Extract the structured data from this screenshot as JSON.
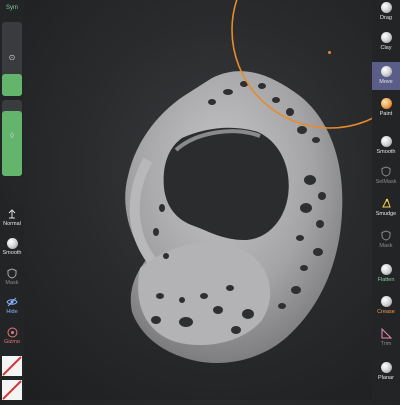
{
  "left_bar": {
    "sym_label": "Sym",
    "radius_slider_level": 0.3,
    "intensity_slider_level": 0.85,
    "tools": [
      {
        "name": "normal",
        "label": "Normal",
        "icon": "arrow-up-icon"
      },
      {
        "name": "smooth",
        "label": "Smooth",
        "icon": "smooth-brush-icon"
      },
      {
        "name": "mask",
        "label": "Mask",
        "icon": "mask-shield-icon"
      },
      {
        "name": "hide",
        "label": "Hide",
        "icon": "hide-eye-icon"
      },
      {
        "name": "gizmo",
        "label": "Gizmo",
        "icon": "gizmo-icon"
      }
    ]
  },
  "right_bar": {
    "tools": [
      {
        "name": "drag",
        "label": "Drag"
      },
      {
        "name": "clay",
        "label": "Clay"
      },
      {
        "name": "move",
        "label": "Move",
        "active": true
      },
      {
        "name": "paint",
        "label": "Paint"
      },
      {
        "name": "smooth",
        "label": "Smooth"
      },
      {
        "name": "selmask",
        "label": "SelMask"
      },
      {
        "name": "smudge",
        "label": "Smudge"
      },
      {
        "name": "mask",
        "label": "Mask"
      },
      {
        "name": "flatten",
        "label": "Flatten"
      },
      {
        "name": "crease",
        "label": "Crease"
      },
      {
        "name": "trim",
        "label": "Trim"
      },
      {
        "name": "planar",
        "label": "Planar"
      }
    ]
  },
  "colors": {
    "accent": "#e88a2a",
    "active_tool_bg": "#5a5d88",
    "slider_fill": "#62b56b",
    "mesh": "#a9a9ab"
  }
}
